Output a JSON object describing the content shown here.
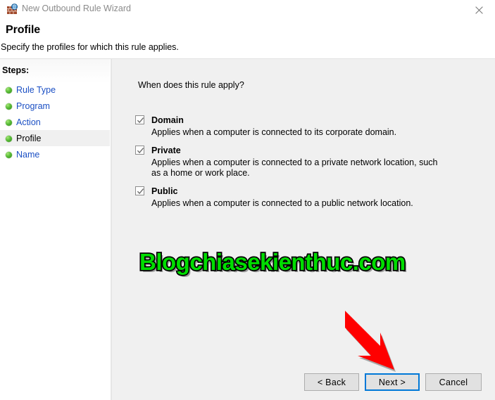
{
  "window": {
    "title": "New Outbound Rule Wizard",
    "icon": "firewall-globe-icon",
    "close_label": "✕"
  },
  "header": {
    "title": "Profile",
    "subtitle": "Specify the profiles for which this rule applies."
  },
  "sidebar": {
    "heading": "Steps:",
    "items": [
      {
        "label": "Rule Type",
        "current": false
      },
      {
        "label": "Program",
        "current": false
      },
      {
        "label": "Action",
        "current": false
      },
      {
        "label": "Profile",
        "current": true
      },
      {
        "label": "Name",
        "current": false
      }
    ]
  },
  "main": {
    "question": "When does this rule apply?",
    "options": [
      {
        "name": "Domain",
        "checked": true,
        "description": "Applies when a computer is connected to its corporate domain."
      },
      {
        "name": "Private",
        "checked": true,
        "description": "Applies when a computer is connected to a private network location, such as a home or work place."
      },
      {
        "name": "Public",
        "checked": true,
        "description": "Applies when a computer is connected to a public network location."
      }
    ]
  },
  "watermark": {
    "text": "Blogchiasekienthuc.com",
    "color": "#00dd00",
    "outline": "#000000"
  },
  "annotation": {
    "arrow_color": "#ff0000",
    "points_to": "Next >"
  },
  "footer": {
    "back_label": "< Back",
    "next_label": "Next >",
    "cancel_label": "Cancel",
    "focus_color": "#0078d7"
  }
}
